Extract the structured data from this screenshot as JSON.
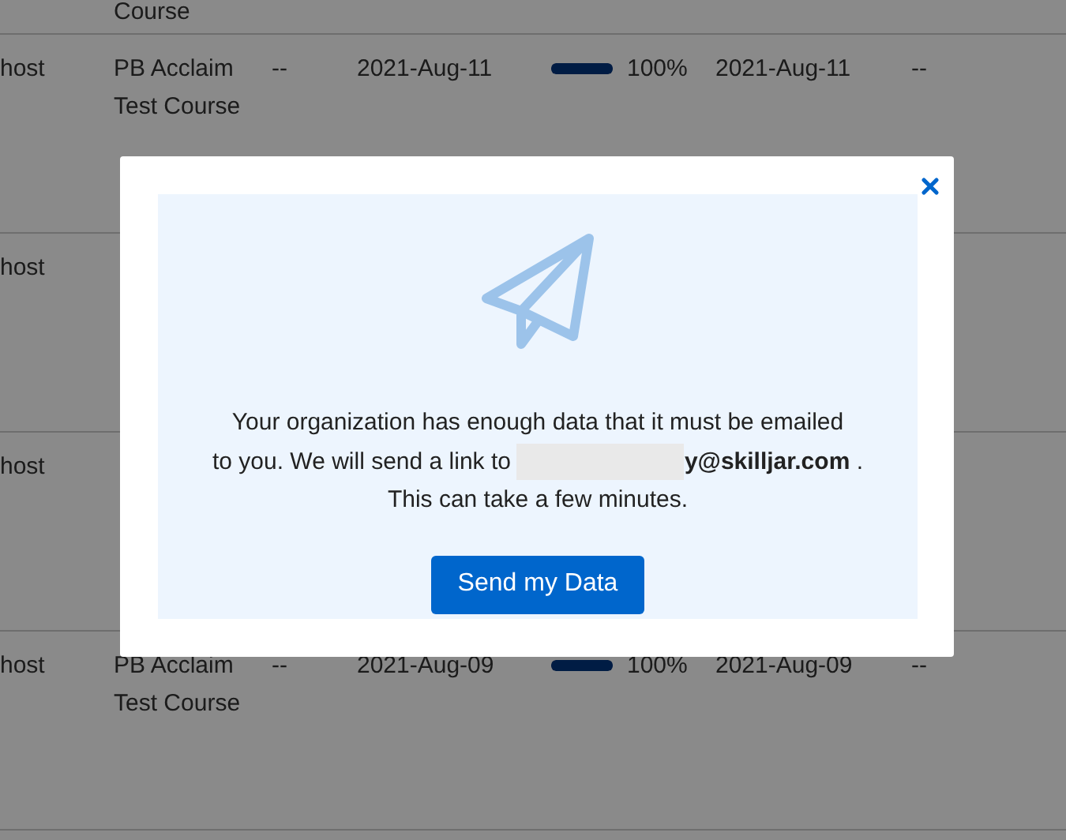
{
  "table": {
    "top_row": {
      "column_2": "Course"
    },
    "rows": [
      {
        "column_1": "host",
        "column_2": "PB Acclaim Test Course",
        "column_3": "--",
        "column_4": "2021-Aug-11",
        "level": 1,
        "column_5": "100%",
        "column_6": "2021-Aug-11",
        "column_7": "--"
      },
      {
        "column_1": "host"
      },
      {
        "column_1": "host"
      },
      {
        "column_1": "host",
        "column_2": "PB Acclaim Test Course",
        "column_3": "--",
        "column_4": "2021-Aug-09",
        "level": 1,
        "column_5": "100%",
        "column_6": "2021-Aug-09",
        "column_7": "--"
      }
    ]
  },
  "dialog": {
    "message_line_1": "Your organization has enough data that it must be emailed",
    "message_line_2": "to you. We will send a link to",
    "email": "**y@skilljar.com** .",
    "message_line_3": "This can take a few minutes.",
    "button": "Send my Data"
  }
}
